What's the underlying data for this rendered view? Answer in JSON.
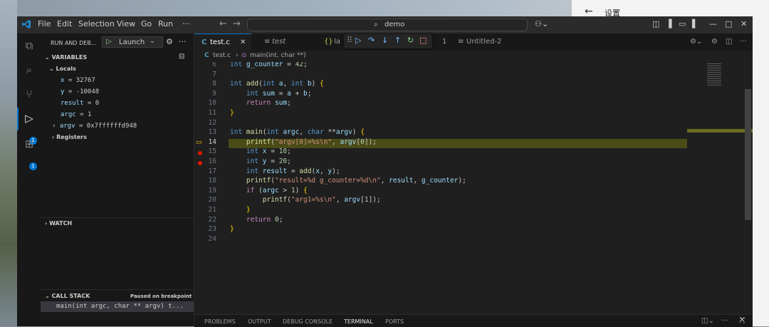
{
  "window": {
    "search_text": "demo"
  },
  "menu": [
    "File",
    "Edit",
    "Selection",
    "View",
    "Go",
    "Run",
    "···"
  ],
  "settings_panel": {
    "back": "←",
    "title": "设置"
  },
  "debug": {
    "header": "RUN AND DEB...",
    "config": "Launch",
    "variables_title": "VARIABLES",
    "locals_label": "Locals",
    "variables": [
      {
        "name": "x",
        "value": " = 32767"
      },
      {
        "name": "y",
        "value": " = -10048"
      },
      {
        "name": "result",
        "value": " = 0"
      },
      {
        "name": "argc",
        "value": " = 1"
      },
      {
        "name": "argv",
        "value": " = 0x7ffffffd948"
      }
    ],
    "registers_label": "Registers",
    "watch_title": "WATCH",
    "callstack_title": "CALL STACK",
    "paused": "Paused on breakpoint",
    "frame": "main(int argc, char ** argv) t..."
  },
  "tabs": [
    {
      "label": "test.c",
      "icon": "C"
    },
    {
      "label": "test",
      "icon": "≡"
    },
    {
      "label": "la",
      "icon": "{}"
    },
    {
      "label": "1",
      "icon": ""
    },
    {
      "label": "Untitled-2",
      "icon": "≡"
    }
  ],
  "breadcrumb": {
    "file": "test.c",
    "symbol": "main(int, char **)"
  },
  "editor": {
    "current_line": 14,
    "breakpoints": [
      15,
      16
    ],
    "lines": [
      {
        "n": "6",
        "text": "int g_counter = 42;"
      },
      {
        "n": "7",
        "text": ""
      },
      {
        "n": "8",
        "text": "int add(int a, int b) {"
      },
      {
        "n": "9",
        "text": "    int sum = a + b;"
      },
      {
        "n": "10",
        "text": "    return sum;"
      },
      {
        "n": "11",
        "text": "}"
      },
      {
        "n": "12",
        "text": ""
      },
      {
        "n": "13",
        "text": "int main(int argc, char **argv) {"
      },
      {
        "n": "14",
        "text": "    printf(\"argv[0]=%s\\n\", argv[0]);"
      },
      {
        "n": "15",
        "text": "    int x = 10;"
      },
      {
        "n": "16",
        "text": "    int y = 20;"
      },
      {
        "n": "17",
        "text": "    int result = add(x, y);"
      },
      {
        "n": "18",
        "text": "    printf(\"result=%d g_counter=%d\\n\", result, g_counter);"
      },
      {
        "n": "19",
        "text": "    if (argc > 1) {"
      },
      {
        "n": "20",
        "text": "        printf(\"arg1=%s\\n\", argv[1]);"
      },
      {
        "n": "21",
        "text": "    }"
      },
      {
        "n": "22",
        "text": "    return 0;"
      },
      {
        "n": "23",
        "text": "}"
      },
      {
        "n": "24",
        "text": ""
      }
    ]
  },
  "panel_tabs": [
    "PROBLEMS",
    "OUTPUT",
    "DEBUG CONSOLE",
    "TERMINAL",
    "PORTS"
  ],
  "panel_active": "TERMINAL",
  "badges": {
    "debug": "1",
    "extensions": "1"
  },
  "accent": "#0078d4"
}
